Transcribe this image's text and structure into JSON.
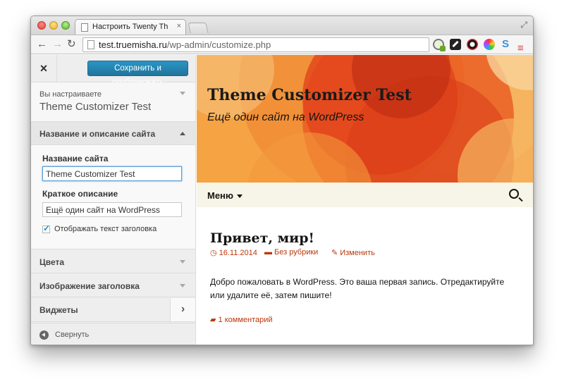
{
  "browser": {
    "tab_title": "Настроить Twenty Thirteen",
    "tab_close": "×",
    "url_host": "test.truemisha.ru",
    "url_path": "/wp-admin/customize.php",
    "nav": {
      "back": "←",
      "forward": "→",
      "reload": "↻"
    },
    "expand_glyph": "⤢",
    "extensions": [
      "seo-plugin-icon",
      "pen-extension-icon",
      "eye-extension-icon",
      "color-wheel-icon",
      "sync-extension-icon"
    ],
    "sync_glyph": "S",
    "menu_glyph": "≡"
  },
  "customizer": {
    "close_glyph": "×",
    "save_button": "Сохранить и опубликовать",
    "customizing_label": "Вы настраиваете",
    "theme_name": "Theme Customizer Test",
    "sections": {
      "site_identity": {
        "title": "Название и описание сайта",
        "site_title_label": "Название сайта",
        "site_title_value": "Theme Customizer Test",
        "tagline_label": "Краткое описание",
        "tagline_value": "Ещё один сайт на WordPress",
        "display_header_text_label": "Отображать текст заголовка",
        "display_header_text_checked": true
      },
      "colors": "Цвета",
      "header_image": "Изображение заголовка",
      "widgets": "Виджеты"
    },
    "widgets_chevron": "›",
    "collapse_label": "Свернуть"
  },
  "preview": {
    "site_title": "Theme Customizer Test",
    "site_description": "Ещё один сайт на WordPress",
    "menu_label": "Меню",
    "post": {
      "title": "Привет, мир!",
      "date_icon": "◷",
      "date": "16.11.2014",
      "category_icon": "▬",
      "category": "Без рубрики",
      "edit_icon": "✎",
      "edit": "Изменить",
      "body": "Добро пожаловать в WordPress. Это ваша первая запись. Отредактируйте или удалите её, затем пишите!",
      "comments_icon": "▰",
      "comments": "1 комментарий"
    }
  },
  "colors": {
    "accent": "#21759b",
    "link": "#bc360a",
    "header_bg": "#f3a64a",
    "navbar_bg": "#f7f5e7"
  }
}
